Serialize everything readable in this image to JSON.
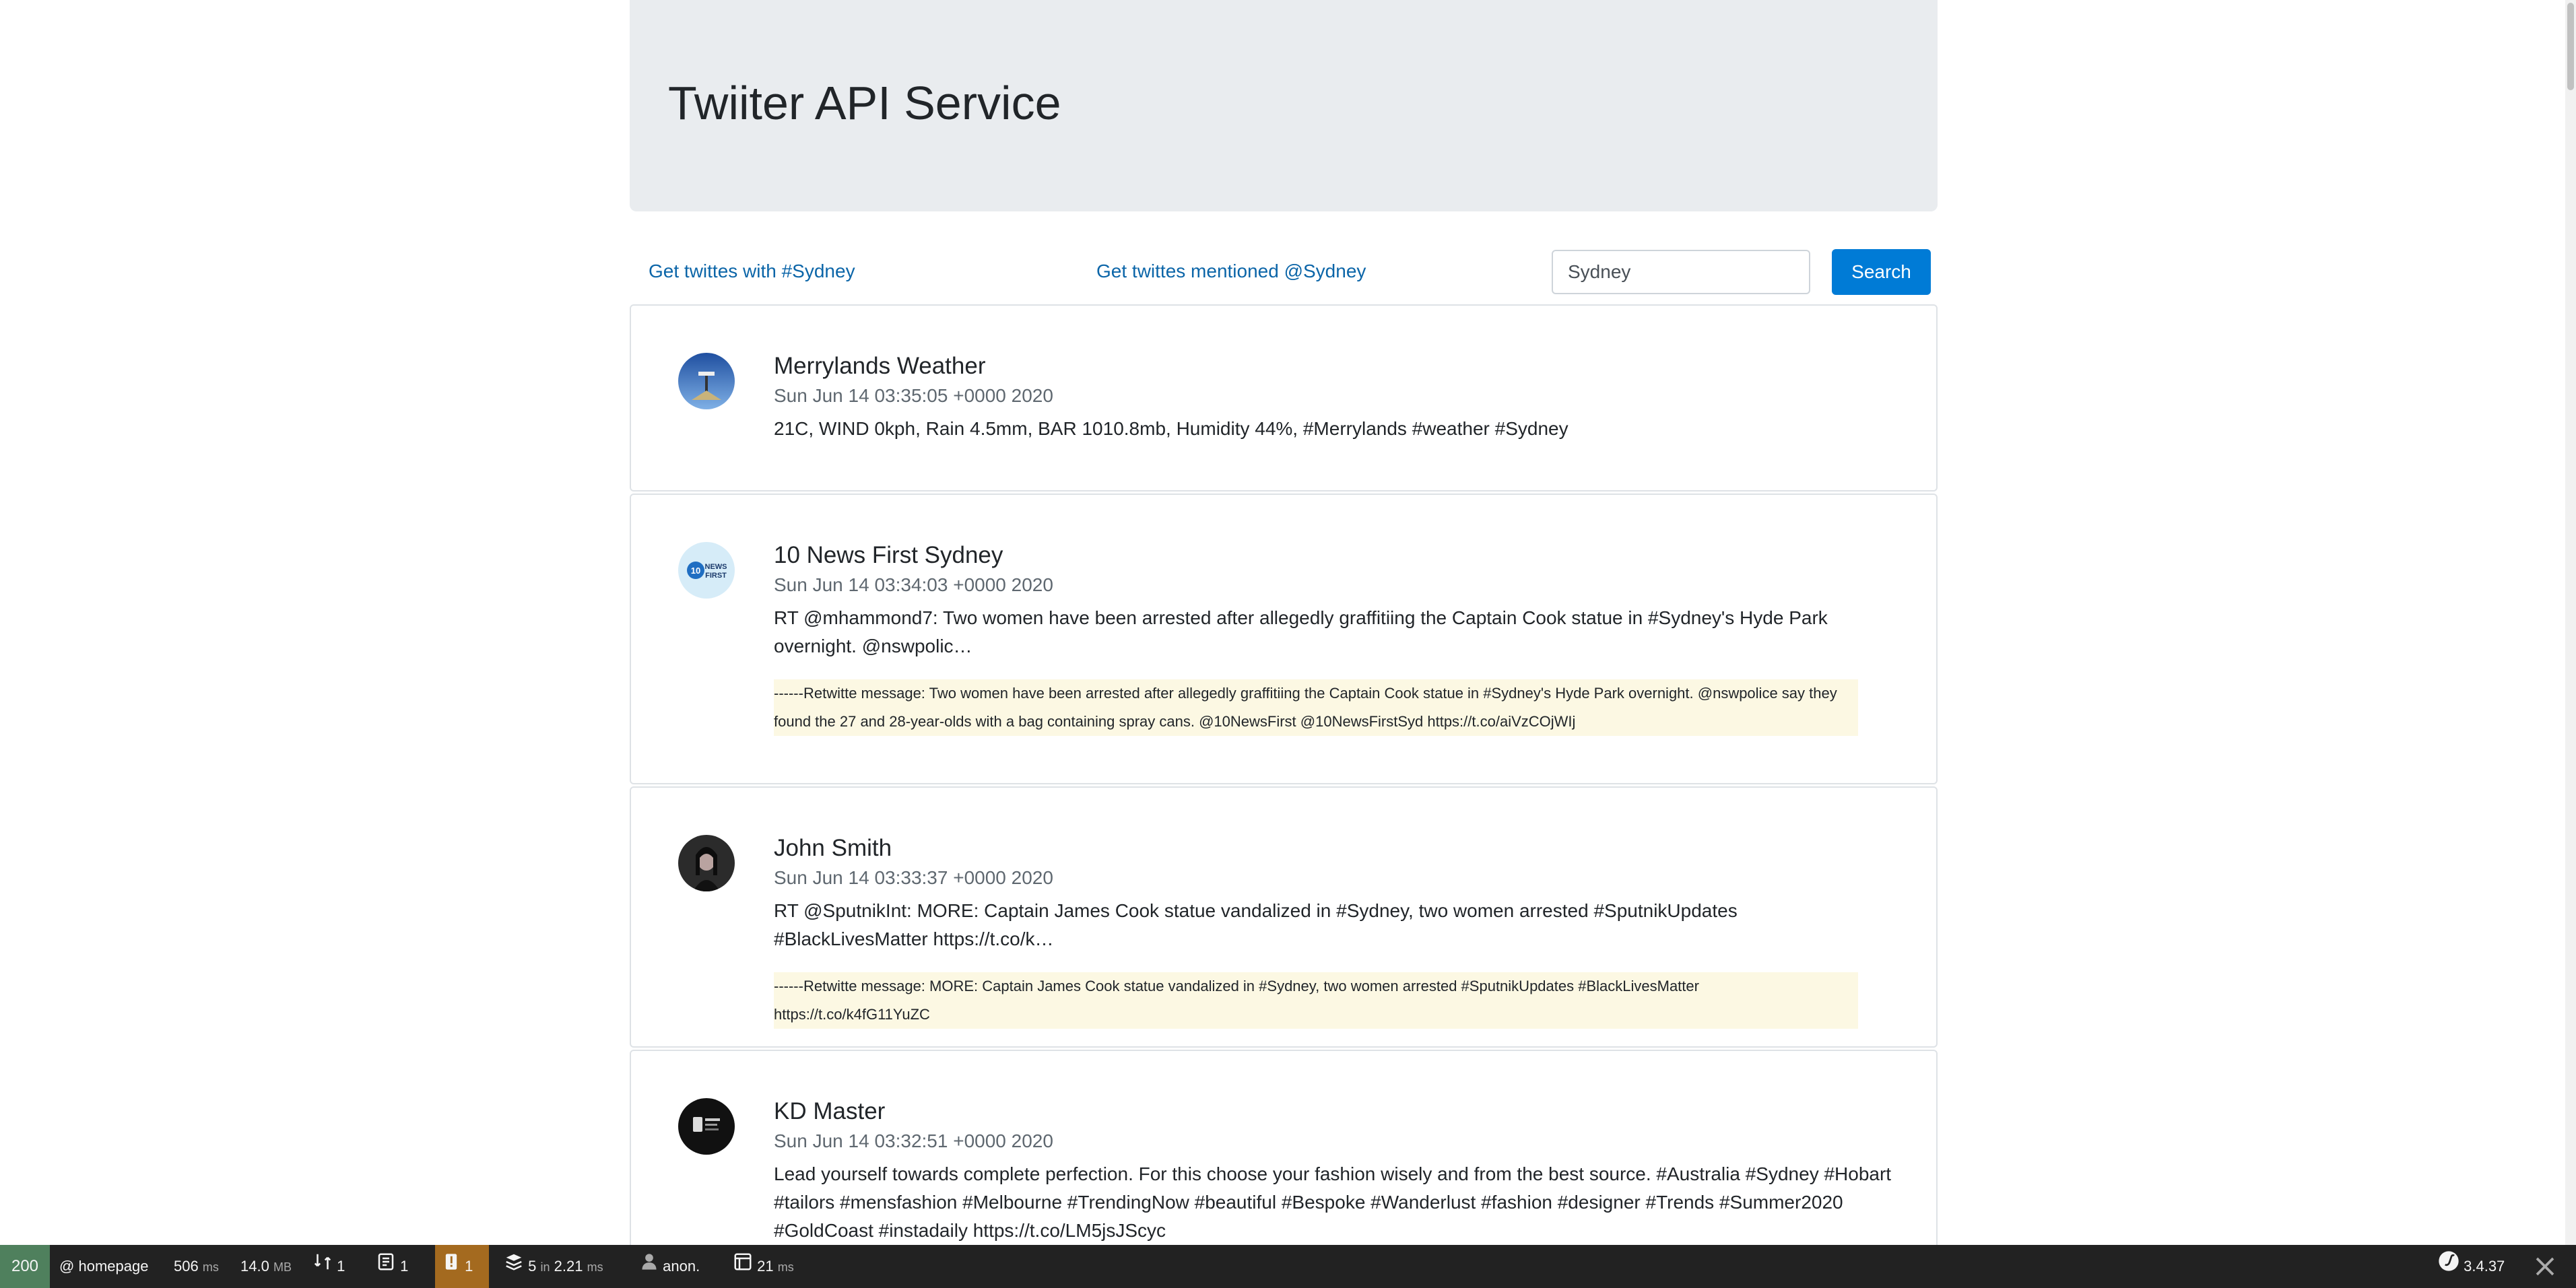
{
  "header": {
    "title": "Twiiter API Service"
  },
  "nav": {
    "hashtag_link": "Get twittes with #Sydney",
    "mention_link": "Get twittes mentioned @Sydney",
    "search_value": "Sydney",
    "search_button": "Search"
  },
  "tweets": [
    {
      "name": "Merrylands Weather",
      "date": "Sun Jun 14 03:35:05 +0000 2020",
      "text": "21C, WIND 0kph, Rain 4.5mm, BAR 1010.8mb, Humidity 44%, #Merrylands #weather #Sydney",
      "retweet": ""
    },
    {
      "name": "10 News First Sydney",
      "date": "Sun Jun 14 03:34:03 +0000 2020",
      "text": "RT @mhammond7: Two women have been arrested after allegedly graffitiing the Captain Cook statue in #Sydney's Hyde Park overnight. @nswpolic…",
      "retweet": "------Retwitte message: Two women have been arrested after allegedly graffitiing the Captain Cook statue in #Sydney's Hyde Park overnight. @nswpolice say they found the 27 and 28-year-olds with a bag containing spray cans. @10NewsFirst @10NewsFirstSyd https://t.co/aiVzCOjWIj"
    },
    {
      "name": "John Smith",
      "date": "Sun Jun 14 03:33:37 +0000 2020",
      "text": "RT @SputnikInt: MORE: Captain James Cook statue vandalized in #Sydney, two women arrested #SputnikUpdates #BlackLivesMatter https://t.co/k…",
      "retweet": "------Retwitte message: MORE: Captain James Cook statue vandalized in #Sydney, two women arrested #SputnikUpdates #BlackLivesMatter https://t.co/k4fG11YuZC"
    },
    {
      "name": "KD Master",
      "date": "Sun Jun 14 03:32:51 +0000 2020",
      "text": "Lead yourself towards complete perfection. For this choose your fashion wisely and from the best source. #Australia #Sydney #Hobart #tailors #mensfashion #Melbourne #TrendingNow #beautiful #Bespoke #Wanderlust #fashion #designer #Trends #Summer2020 #GoldCoast #instadaily https://t.co/LM5jsJScyc",
      "retweet": ""
    }
  ],
  "toolbar": {
    "status_code": "200",
    "route": "homepage",
    "time_value": "506",
    "time_unit": "ms",
    "memory_value": "14.0",
    "memory_unit": "MB",
    "requests_count": "1",
    "forms_count": "1",
    "warnings_count": "1",
    "db_queries": "5",
    "db_in": "in",
    "db_time": "2.21",
    "db_unit": "ms",
    "user": "anon.",
    "render_time": "21",
    "render_unit": "ms",
    "version": "3.4.37",
    "colors": {
      "status": "#4f805d",
      "warning": "#a46a1f",
      "background": "#222222"
    }
  }
}
